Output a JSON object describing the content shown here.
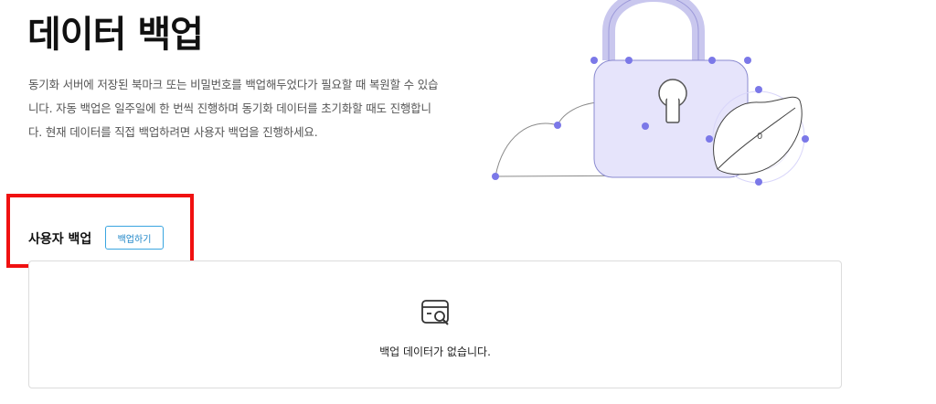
{
  "header": {
    "title": "데이터 백업",
    "description_lines": [
      "동기화 서버에 저장된 북마크 또는 비밀번호를 백업해두었다가 필요할 때 복원할 수 있습",
      "니다. 자동 백업은 일주일에 한 번씩 진행하며 동기화 데이터를 초기화할 때도 진행합니",
      "다. 현재 데이터를 직접 백업하려면 사용자 백업을 진행하세요."
    ]
  },
  "illustration": {
    "icons": [
      "lock-icon",
      "cloud-icon",
      "leaf-icon"
    ],
    "accent_color": "#7b78e8",
    "lock_fill": "#e6e4fb",
    "leaf_label": "0"
  },
  "user_backup": {
    "title": "사용자 백업",
    "button_label": "백업하기",
    "highlight_color": "#f01111"
  },
  "empty_state": {
    "icon": "empty-data-search-icon",
    "message": "백업 데이터가 없습니다."
  }
}
